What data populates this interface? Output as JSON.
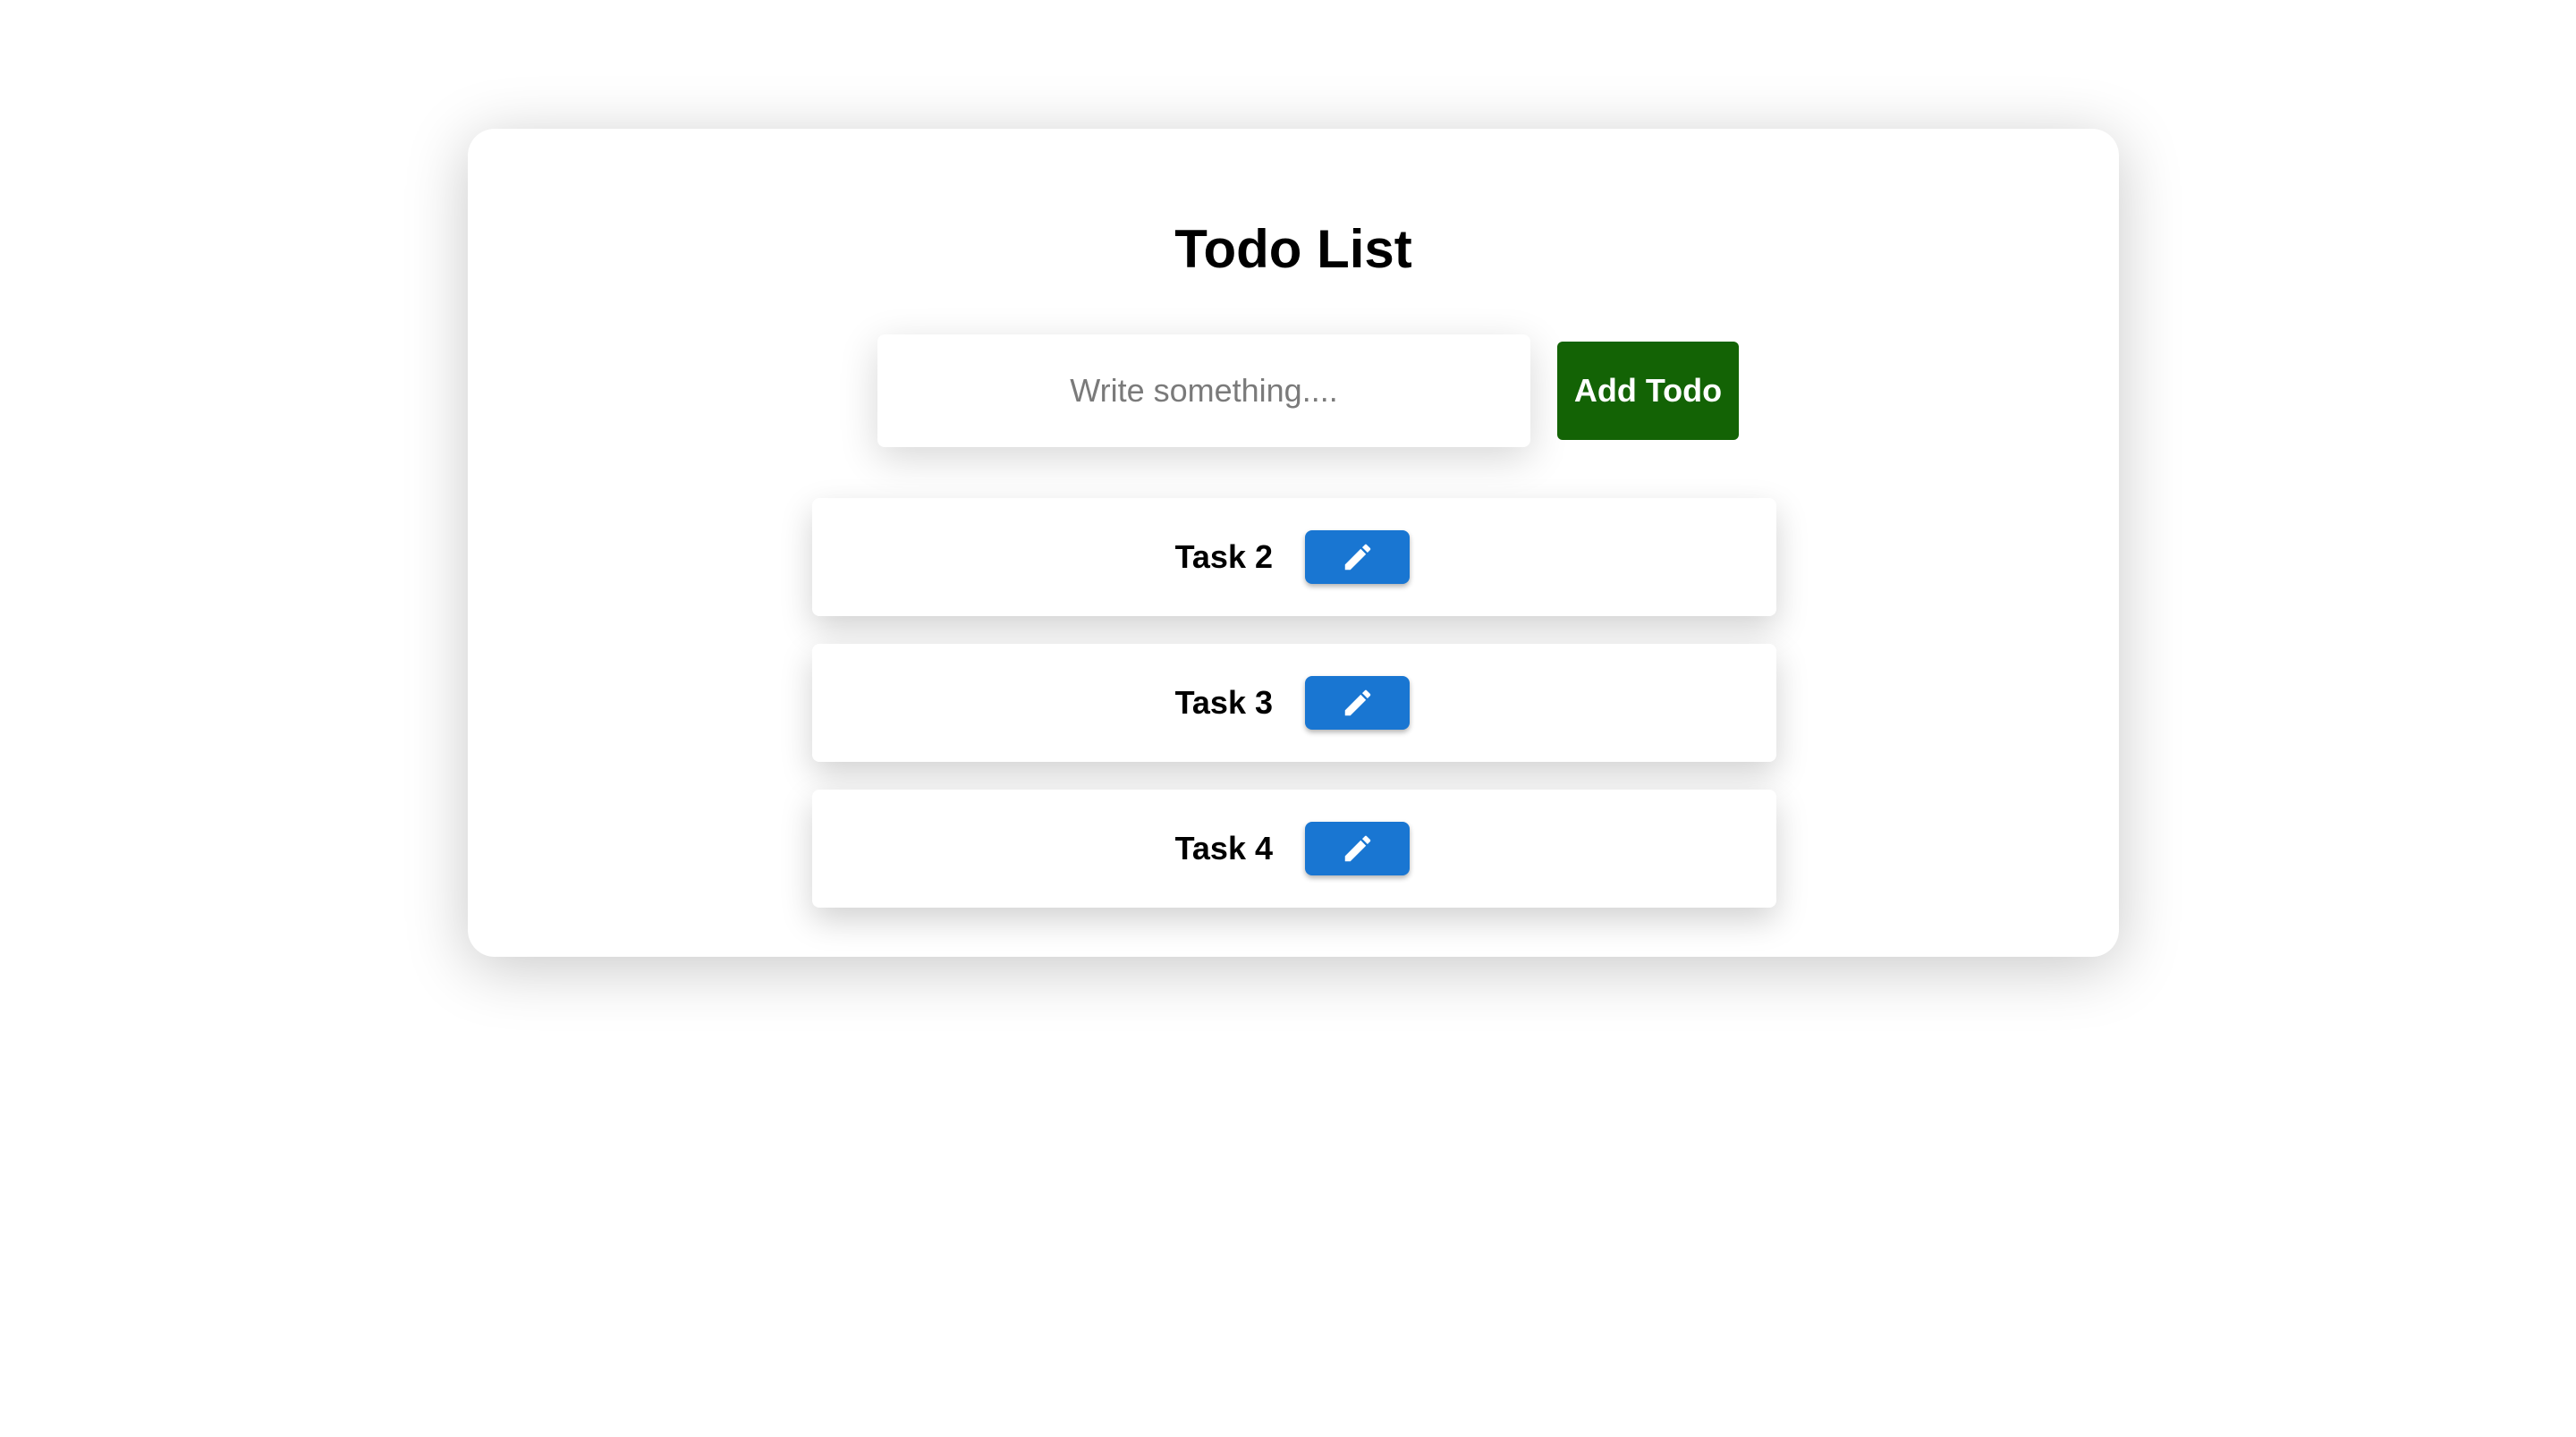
{
  "page": {
    "title": "Todo List"
  },
  "form": {
    "input_placeholder": "Write something....",
    "input_value": "",
    "add_button_label": "Add Todo"
  },
  "todos": [
    {
      "label": "Task 2",
      "action_icon": "pencil-icon"
    },
    {
      "label": "Task 3",
      "action_icon": "pencil-icon"
    },
    {
      "label": "Task 4",
      "action_icon": "pencil-icon"
    }
  ],
  "colors": {
    "add_button": "#136305",
    "edit_button": "#1976d2",
    "background": "#ffffff"
  }
}
